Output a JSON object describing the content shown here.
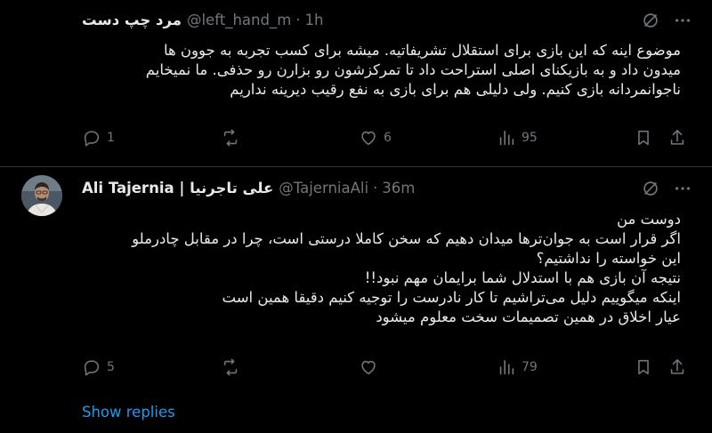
{
  "tweets": [
    {
      "name": "مرد چپ دست",
      "handle": "@left_hand_m",
      "dot": "·",
      "time": "1h",
      "lines": [
        "موضوع اینه که این بازی برای استقلال تشریفاتیه. میشه برای کسب تجربه به جوون ها",
        "میدون داد و به بازیکنای اصلی استراحت داد تا تمرکزشون رو بزارن رو حذفی. ما نمیخایم",
        "ناجوانمردانه بازی کنیم. ولی دلیلی هم برای بازی به نفع رقیب دیرینه نداریم"
      ],
      "replies": "1",
      "reposts": "",
      "likes": "6",
      "views": "95"
    },
    {
      "name": "Ali Tajernia | علی تاجرنیا",
      "handle": "@TajerniaAli",
      "dot": "·",
      "time": "36m",
      "lines": [
        "دوست من",
        "اگر قرار است به جوان‌ترها میدان دهیم که سخن کاملا درستی است، چرا در مقابل چادرملو",
        "این خواسته را نداشتیم؟",
        "نتیجه آن بازی هم با استدلال شما برایمان مهم نبود!!",
        "اینکه میگوییم دلیل می‌تراشیم تا کار نادرست را توجیه کنیم دقیقا همین است",
        "عیار اخلاق در همین تصمیمات سخت معلوم میشود"
      ],
      "replies": "5",
      "reposts": "",
      "likes": "",
      "views": "79"
    }
  ],
  "show_replies": "Show replies",
  "icons": {
    "reply": "reply-icon",
    "repost": "repost-icon",
    "like": "heart-icon",
    "views": "views-icon",
    "bookmark": "bookmark-icon",
    "share": "share-icon",
    "grok": "grok-icon",
    "more": "more-icon"
  },
  "colors": {
    "background": "#000000",
    "text": "#e7e9ea",
    "muted": "#71767b",
    "link": "#1d9bf0",
    "divider": "#2f3336"
  }
}
